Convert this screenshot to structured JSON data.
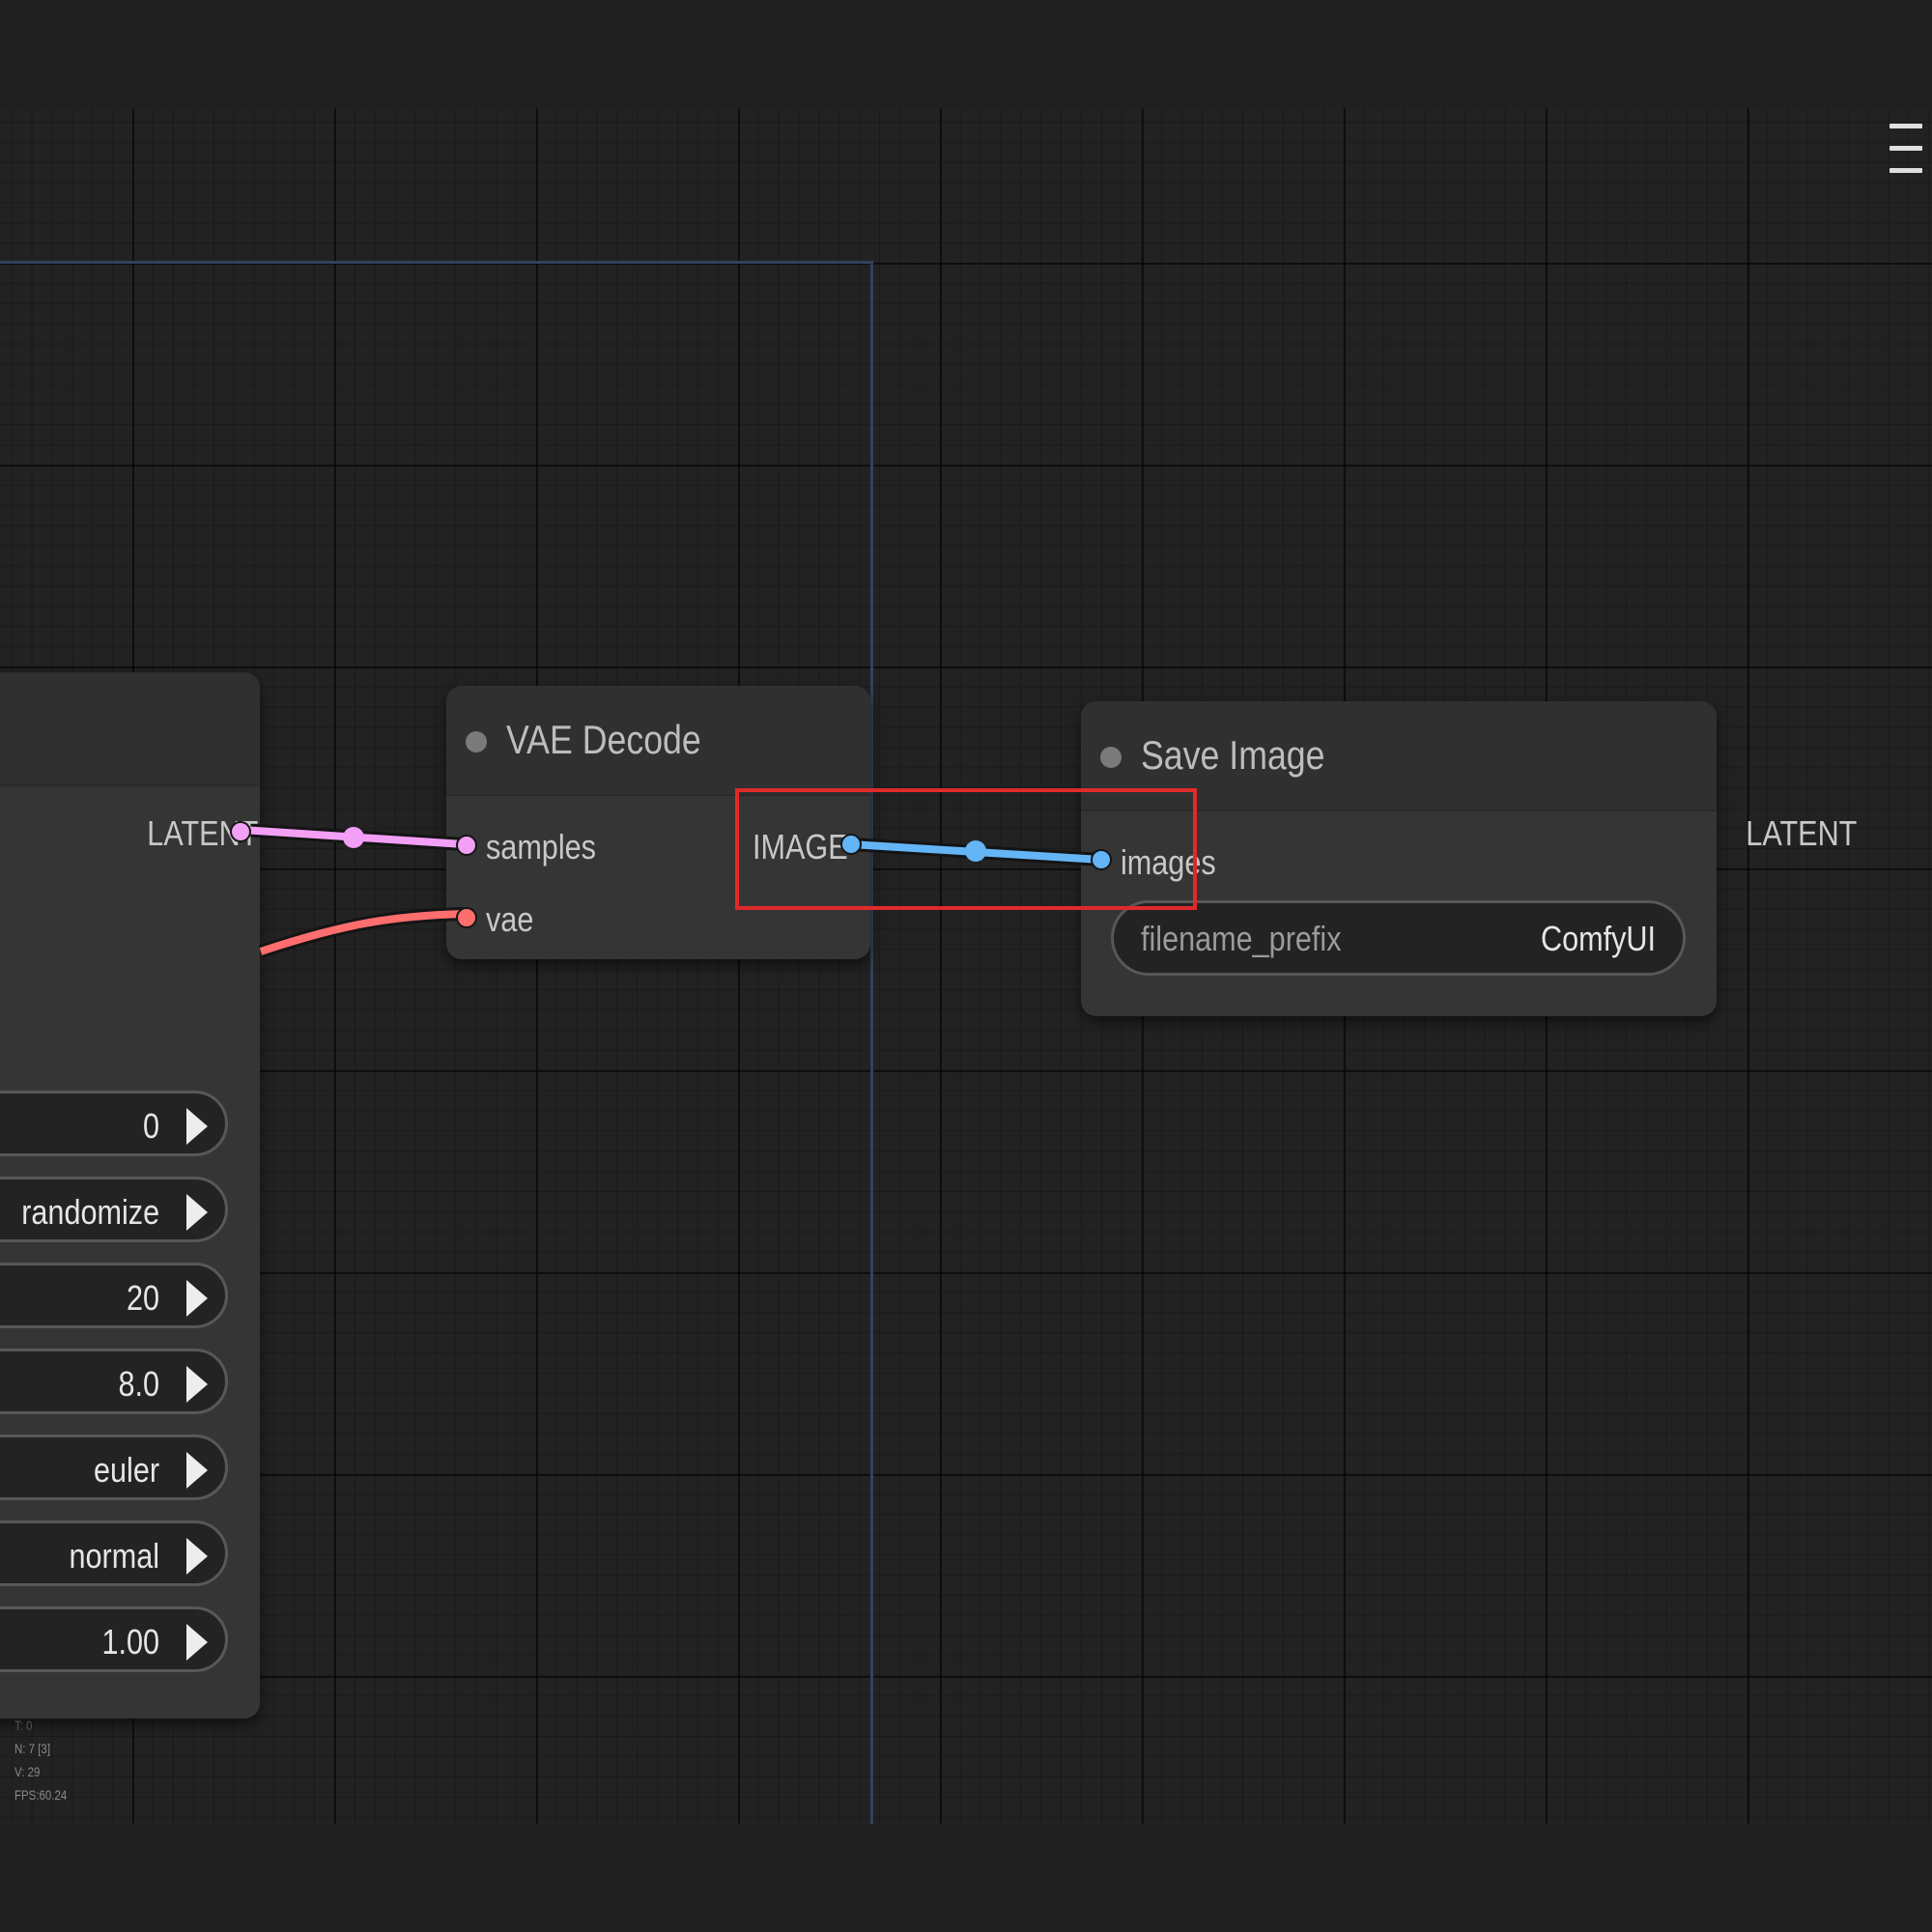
{
  "app": {
    "menu_icon": "hamburger-menu-icon"
  },
  "colors": {
    "latent": "#f29ff5",
    "image": "#64b5f6",
    "vae": "#ff6e6e",
    "highlight": "#e02a2a"
  },
  "ksampler": {
    "output_latent": "LATENT",
    "widgets": [
      {
        "value": "0"
      },
      {
        "value": "randomize"
      },
      {
        "value": "20"
      },
      {
        "value": "8.0"
      },
      {
        "value": "euler"
      },
      {
        "value": "normal"
      },
      {
        "value": "1.00"
      }
    ]
  },
  "vae_decode": {
    "title": "VAE Decode",
    "input_samples": "samples",
    "input_vae": "vae",
    "output_image": "IMAGE"
  },
  "save_image": {
    "title": "Save Image",
    "input_images": "images",
    "widget_label": "filename_prefix",
    "widget_value": "ComfyUI"
  },
  "stats": {
    "line0": "T: 0",
    "line1": "N: 7 [3]",
    "line2": "V: 29",
    "line3": "FPS:60.24"
  }
}
